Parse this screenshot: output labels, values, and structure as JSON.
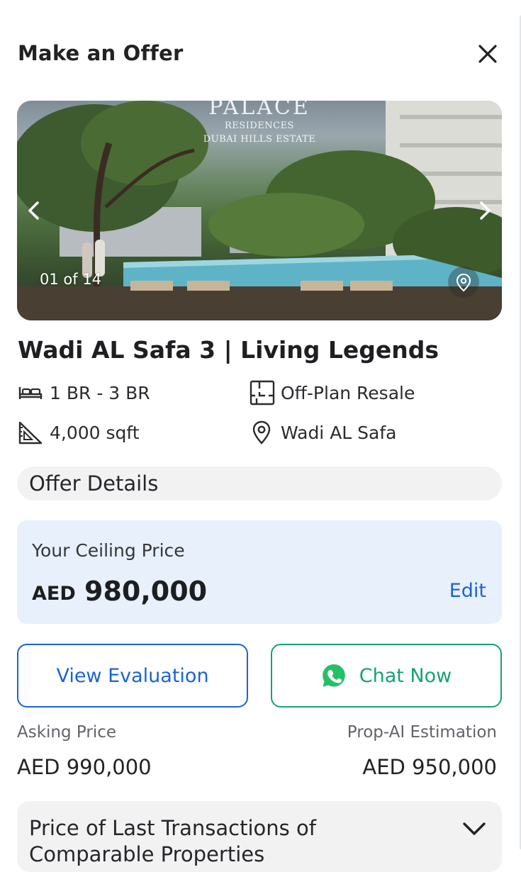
{
  "header": {
    "title": "Make an Offer",
    "close_icon": "close-icon"
  },
  "gallery": {
    "brand_main": "PALACE",
    "brand_line1": "RESIDENCES",
    "brand_line2": "DUBAI HILLS ESTATE",
    "counter": "01 of 14",
    "prev_icon": "chevron-left-icon",
    "next_icon": "chevron-right-icon",
    "map_icon": "location-pin-icon"
  },
  "listing": {
    "title": "Wadi AL Safa 3 | Living Legends",
    "features": {
      "bedrooms": "1 BR - 3 BR",
      "type": "Off-Plan Resale",
      "area": "4,000 sqft",
      "location": "Wadi AL Safa"
    }
  },
  "offer_details": {
    "section_title": "Offer Details",
    "ceiling_label": "Your Ceiling Price",
    "currency": "AED",
    "ceiling_amount": "980,000",
    "edit_label": "Edit"
  },
  "actions": {
    "view_evaluation": "View Evaluation",
    "chat_now": "Chat Now"
  },
  "prices": {
    "asking_label": "Asking Price",
    "asking_value": "AED 990,000",
    "estimation_label": "Prop-AI Estimation",
    "estimation_value": "AED 950,000"
  },
  "transactions": {
    "title": "Price of Last Transactions of Comparable Properties"
  },
  "colors": {
    "accent_blue": "#1c64d1",
    "whatsapp_green": "#14a373",
    "ceiling_bg": "#e8f0fb",
    "section_bg": "#f2f2f3"
  }
}
